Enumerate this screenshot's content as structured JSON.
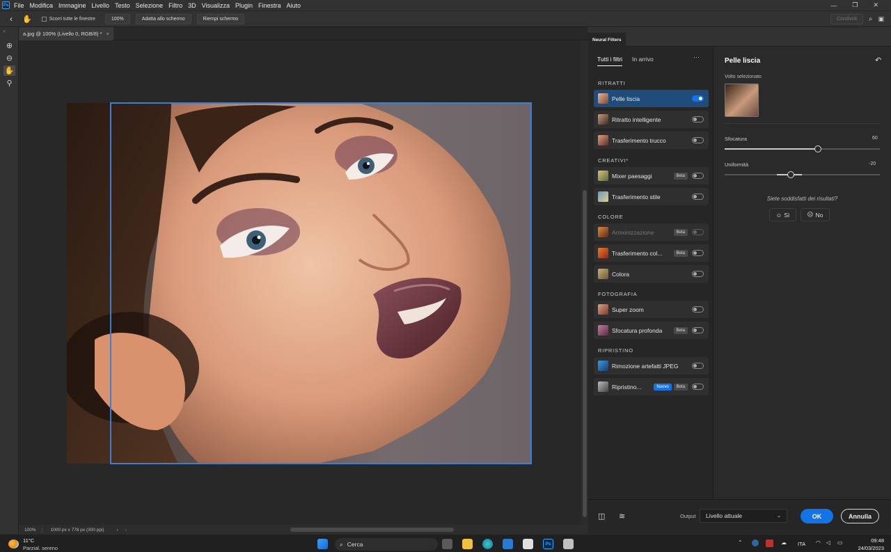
{
  "menubar": {
    "items": [
      "File",
      "Modifica",
      "Immagine",
      "Livello",
      "Testo",
      "Selezione",
      "Filtro",
      "3D",
      "Visualizza",
      "Plugin",
      "Finestra",
      "Aiuto"
    ],
    "ps_label": "Ps"
  },
  "window_controls": {
    "minimize": "—",
    "restore": "❐",
    "close": "✕"
  },
  "options_bar": {
    "scroll_all_label": "Scorri tutte le finestre",
    "zoom_100_label": "100%",
    "fit_screen_label": "Adatta allo schermo",
    "fill_screen_label": "Riempi schermo",
    "share_label": "Condividi"
  },
  "document": {
    "tab_title": "a.jpg @ 100% (Livello 0, RGB/8) *",
    "tab_close": "×",
    "zoom": "100%",
    "doc_size": "1000 px x 778 px (300 ppi)"
  },
  "neural_filters": {
    "panel_tab": "Neural Filters",
    "tabs": [
      "Tutti i filtri",
      "In arrivo"
    ],
    "more": "···",
    "sections": {
      "ritratti": "RITRATTI",
      "creativi": "CREATIVI*",
      "colore": "COLORE",
      "fotografia": "FOTOGRAFIA",
      "ripristino": "RIPRISTINO"
    },
    "filters": [
      {
        "label": "Pelle liscia",
        "on": true
      },
      {
        "label": "Ritratto intelligente",
        "on": false
      },
      {
        "label": "Trasferimento trucco",
        "on": false
      },
      {
        "label": "Mixer paesaggi",
        "badge": "Beta",
        "on": false
      },
      {
        "label": "Trasferimento stile",
        "on": false
      },
      {
        "label": "Armonizzazione",
        "badge": "Beta",
        "on": false
      },
      {
        "label": "Trasferimento col...",
        "badge": "Beta",
        "on": false
      },
      {
        "label": "Colora",
        "on": false
      },
      {
        "label": "Super zoom",
        "on": false
      },
      {
        "label": "Sfocatura profonda",
        "badge": "Beta",
        "on": false
      },
      {
        "label": "Rimozione artefatti JPEG",
        "on": false
      },
      {
        "label": "Ripristino...",
        "badge_new": "Nuovo",
        "badge": "Beta",
        "on": false
      }
    ]
  },
  "filter_settings": {
    "title": "Pelle liscia",
    "face_label": "Volto selezionato",
    "blur_label": "Sfocatura",
    "blur_value": "60",
    "blur_fraction": 0.6,
    "smooth_label": "Uniformità",
    "smooth_value": "-20",
    "smooth_fraction": 0.4,
    "question": "Siete soddisfatti dei risultati?",
    "yes": "Sì",
    "no": "No"
  },
  "footer": {
    "output_label": "Output",
    "output_value": "Livello attuale",
    "ok": "OK",
    "cancel": "Annulla"
  },
  "taskbar": {
    "temperature": "11°C",
    "weather": "Parzial. sereno",
    "search": "Cerca",
    "lang": "ITA",
    "time": "09:48",
    "date": "24/03/2023"
  }
}
